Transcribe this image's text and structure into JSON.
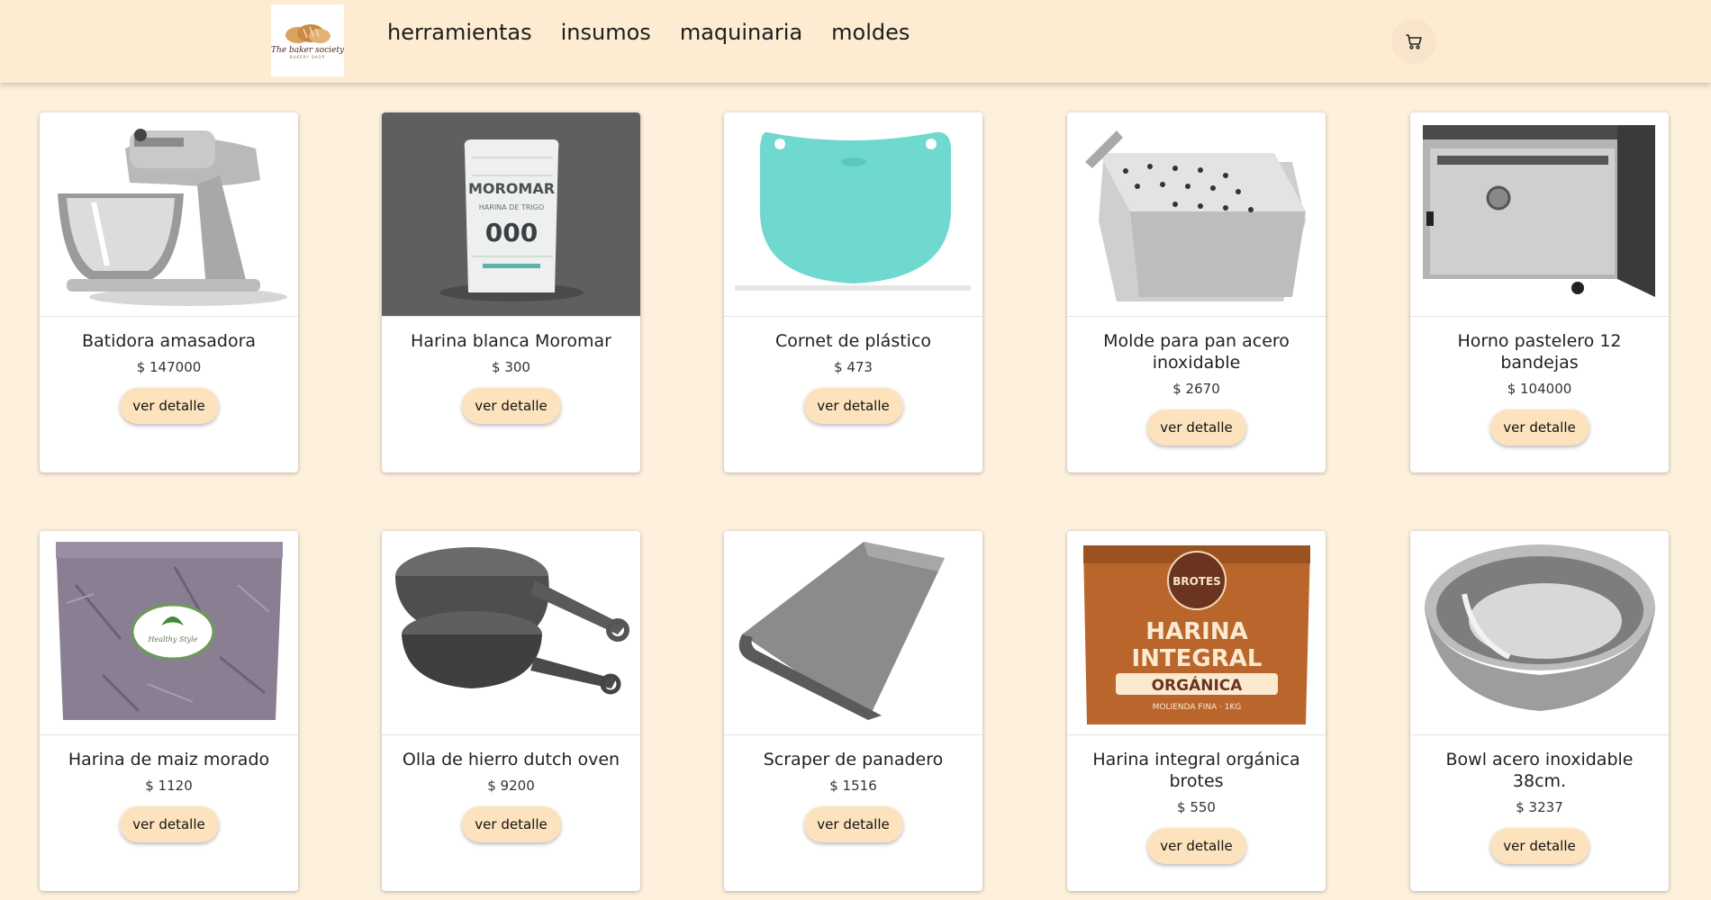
{
  "brand": {
    "logo_text": "The baker society",
    "logo_subtext": "BAKERY SHOP"
  },
  "nav": {
    "links": [
      "herramientas",
      "insumos",
      "maquinaria",
      "moldes"
    ]
  },
  "colors": {
    "page_background": "#fdf0dd",
    "navbar_background": "#fdebd2",
    "button_background": "#fde3bd"
  },
  "icons": {
    "cart": "shopping-cart-icon"
  },
  "products": [
    {
      "name": "Batidora amasadora",
      "price": "$ 147000",
      "button": "ver detalle"
    },
    {
      "name": "Harina blanca Moromar",
      "price": "$ 300",
      "button": "ver detalle",
      "image_text": {
        "brand": "MOROMAR",
        "grade": "000",
        "type": "HARINA DE TRIGO"
      }
    },
    {
      "name": "Cornet de plástico",
      "price": "$ 473",
      "button": "ver detalle"
    },
    {
      "name": "Molde para pan acero inoxidable",
      "price": "$ 2670",
      "button": "ver detalle"
    },
    {
      "name": "Horno pastelero 12 bandejas",
      "price": "$ 104000",
      "button": "ver detalle"
    },
    {
      "name": "Harina de maiz morado",
      "price": "$ 1120",
      "button": "ver detalle",
      "image_text": {
        "label": "Healthy Style"
      }
    },
    {
      "name": "Olla de hierro dutch oven",
      "price": "$ 9200",
      "button": "ver detalle"
    },
    {
      "name": "Scraper de panadero",
      "price": "$ 1516",
      "button": "ver detalle"
    },
    {
      "name": "Harina integral orgánica brotes",
      "price": "$ 550",
      "button": "ver detalle",
      "image_text": {
        "brand": "BROTES",
        "line1": "HARINA",
        "line2": "INTEGRAL",
        "line3": "ORGÁNICA",
        "detail": "MOLIENDA FINA · 1KG"
      }
    },
    {
      "name": "Bowl acero inoxidable 38cm.",
      "price": "$ 3237",
      "button": "ver detalle"
    }
  ]
}
